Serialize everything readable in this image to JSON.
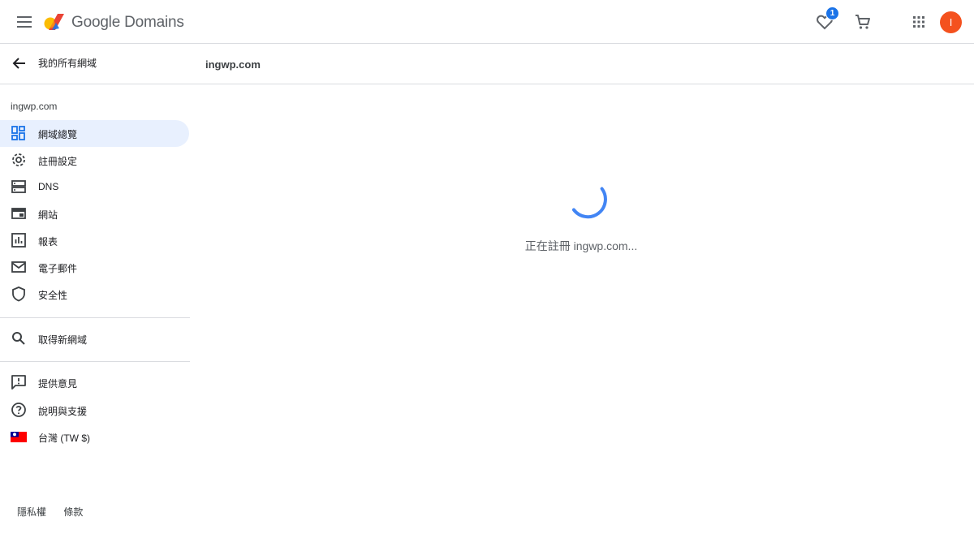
{
  "header": {
    "brand": "Google Domains",
    "favorites_count": "1",
    "avatar_initial": "I"
  },
  "sidebar": {
    "back_label": "我的所有網域",
    "domain": "ingwp.com",
    "items": [
      {
        "label": "網域總覽",
        "icon": "dashboard-icon"
      },
      {
        "label": "註冊設定",
        "icon": "gear-icon"
      },
      {
        "label": "DNS",
        "icon": "dns-icon"
      },
      {
        "label": "網站",
        "icon": "website-icon"
      },
      {
        "label": "報表",
        "icon": "report-icon"
      },
      {
        "label": "電子郵件",
        "icon": "mail-icon"
      },
      {
        "label": "安全性",
        "icon": "shield-icon"
      }
    ],
    "search_label": "取得新網域",
    "feedback_label": "提供意見",
    "help_label": "說明與支援",
    "region_label": "台灣 (TW $)",
    "footer": {
      "privacy": "隱私權",
      "terms": "條款"
    }
  },
  "main": {
    "title": "ingwp.com",
    "loading_text": "正在註冊 ingwp.com..."
  },
  "colors": {
    "accent": "#1a73e8",
    "active_bg": "#e8f0fe",
    "avatar": "#f4511e"
  }
}
